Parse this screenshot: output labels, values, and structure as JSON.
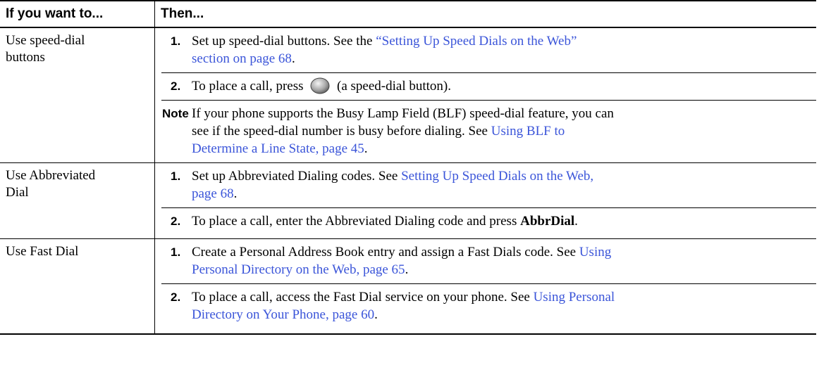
{
  "headers": {
    "col1": "If you want to...",
    "col2": "Then..."
  },
  "rows": [
    {
      "label_1": "Use speed-dial",
      "label_2": "buttons",
      "step1_num": "1.",
      "step1_text": "Set up speed-dial buttons. See the ",
      "step1_link_1": "“Setting Up Speed Dials on the Web”",
      "step1_link_2": "section on page 68",
      "step1_end": ".",
      "step2_num": "2.",
      "step2_pre": "To place a call, press",
      "step2_post": "(a speed-dial button).",
      "note_label": "Note",
      "note_l1": "If your phone supports the Busy Lamp Field (BLF) speed-dial feature, you can",
      "note_l2a": "see if the speed-dial number is busy before dialing. See ",
      "note_link_1": "Using BLF to",
      "note_link_2": "Determine a Line State, page 45",
      "note_end": "."
    },
    {
      "label_1": "Use Abbreviated",
      "label_2": "Dial",
      "step1_num": "1.",
      "step1_text": "Set up Abbreviated Dialing codes. See ",
      "step1_link_1": "Setting Up Speed Dials on the Web,",
      "step1_link_2": "page 68",
      "step1_end": ".",
      "step2_num": "2.",
      "step2_pre": "To place a call, enter the Abbreviated Dialing code and press ",
      "step2_bold": "AbbrDial",
      "step2_end": "."
    },
    {
      "label_1": "Use Fast Dial",
      "step1_num": "1.",
      "step1_text": "Create a Personal Address Book entry and assign a Fast Dials code. See ",
      "step1_link_1": "Using",
      "step1_link_2": "Personal Directory on the Web, page 65",
      "step1_end": ".",
      "step2_num": "2.",
      "step2_pre": "To place a call, access the Fast Dial service on your phone. See ",
      "step2_link_1": "Using Personal",
      "step2_link_2": "Directory on Your Phone, page 60",
      "step2_end": "."
    }
  ]
}
